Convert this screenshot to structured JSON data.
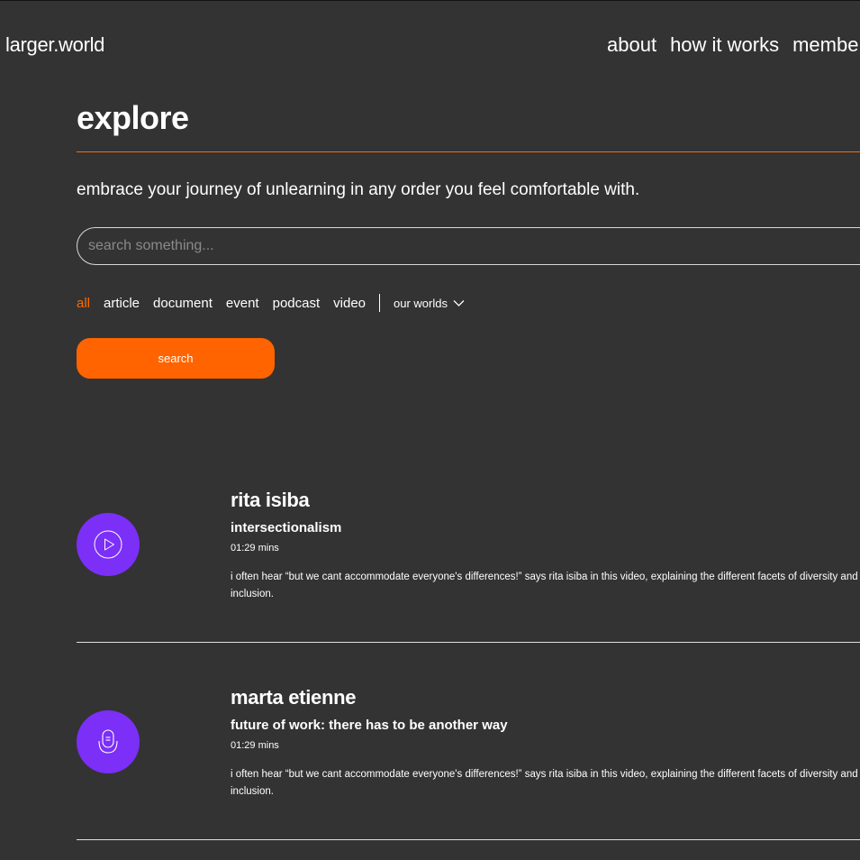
{
  "header": {
    "logo": "larger.world",
    "nav": [
      "about",
      "how it works",
      "members"
    ]
  },
  "main": {
    "title": "explore",
    "intro": "embrace your journey of unlearning in any order you feel comfortable with.",
    "search": {
      "placeholder": "search something..."
    },
    "filters": [
      "all",
      "article",
      "document",
      "event",
      "podcast",
      "video"
    ],
    "active_filter": "all",
    "worlds_label": "our worlds",
    "search_button": "search"
  },
  "results": [
    {
      "icon": "play-icon",
      "name": "rita isiba",
      "topic": "intersectionalism",
      "duration": "01:29 mins",
      "description": "i often hear “but we cant accommodate everyone's differences!” says rita isiba in this video, explaining the different facets of diversity and inclusion."
    },
    {
      "icon": "microphone-icon",
      "name": "marta etienne",
      "topic": "future of work: there has to be another way",
      "duration": "01:29 mins",
      "description": "i often hear “but we cant accommodate everyone's differences!” says rita isiba in this video, explaining the different facets of diversity and inclusion."
    }
  ],
  "colors": {
    "accent": "#ff6400",
    "background": "#333333",
    "icon_circle": "#7b2ff7"
  }
}
